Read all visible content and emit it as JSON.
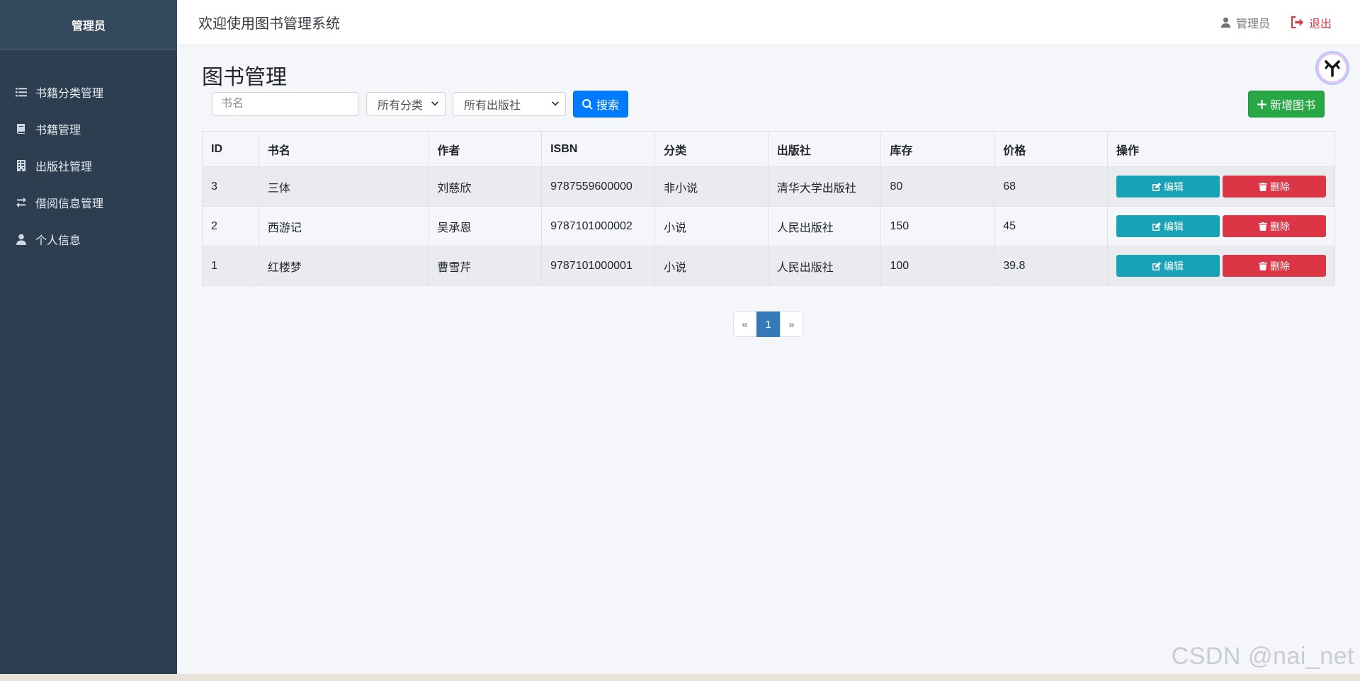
{
  "sidebar": {
    "title": "管理员",
    "items": [
      {
        "label": "书籍分类管理",
        "icon": "list-icon"
      },
      {
        "label": "书籍管理",
        "icon": "book-icon"
      },
      {
        "label": "出版社管理",
        "icon": "building-icon"
      },
      {
        "label": "借阅信息管理",
        "icon": "exchange-icon"
      },
      {
        "label": "个人信息",
        "icon": "user-icon"
      }
    ]
  },
  "header": {
    "title": "欢迎使用图书管理系统",
    "user_label": "管理员",
    "logout_label": "退出"
  },
  "main": {
    "page_title": "图书管理",
    "search_placeholder": "书名",
    "category_select": "所有分类",
    "publisher_select": "所有出版社",
    "search_label": "搜索",
    "add_label": "新增图书"
  },
  "table": {
    "columns": [
      "ID",
      "书名",
      "作者",
      "ISBN",
      "分类",
      "出版社",
      "库存",
      "价格",
      "操作"
    ],
    "rows": [
      {
        "id": "3",
        "name": "三体",
        "author": "刘慈欣",
        "isbn": "9787559600000",
        "category": "非小说",
        "publisher": "清华大学出版社",
        "stock": "80",
        "price": "68"
      },
      {
        "id": "2",
        "name": "西游记",
        "author": "吴承恩",
        "isbn": "9787101000002",
        "category": "小说",
        "publisher": "人民出版社",
        "stock": "150",
        "price": "45"
      },
      {
        "id": "1",
        "name": "红楼梦",
        "author": "曹雪芹",
        "isbn": "9787101000001",
        "category": "小说",
        "publisher": "人民出版社",
        "stock": "100",
        "price": "39.8"
      }
    ],
    "edit_label": "编辑",
    "delete_label": "删除"
  },
  "pagination": {
    "prev": "«",
    "current": "1",
    "next": "»"
  },
  "watermark": "CSDN @nai_net",
  "colors": {
    "sidebar_bg": "#2c3e50",
    "primary": "#007bff",
    "success": "#28a745",
    "info": "#17a2b8",
    "danger": "#dc3545"
  }
}
